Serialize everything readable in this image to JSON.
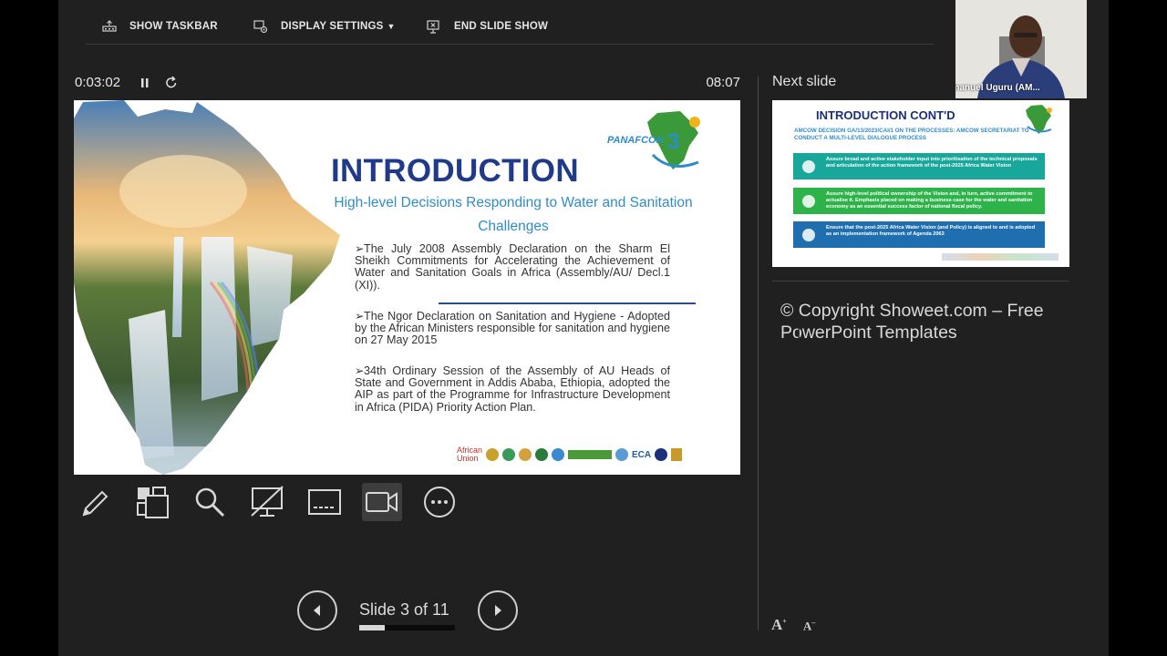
{
  "topbar": {
    "show_taskbar": "SHOW TASKBAR",
    "display_settings": "DISPLAY SETTINGS",
    "end_slide_show": "END SLIDE SHOW"
  },
  "timer": {
    "elapsed": "0:03:02",
    "clock": "08:07"
  },
  "slide": {
    "title": "INTRODUCTION",
    "subtitle": "High-level Decisions Responding to Water and Sanitation Challenges",
    "bullets": [
      "The July 2008 Assembly Declaration on the Sharm El Sheikh Commitments for Accelerating the Achievement of Water and Sanitation Goals in Africa (Assembly/AU/ Decl.1 (XI)).",
      "The Ngor Declaration on Sanitation and Hygiene - Adopted by the African Ministers responsible for sanitation and hygiene on 27 May 2015",
      "34th Ordinary Session of the Assembly of AU Heads of State and Government in Addis Ababa, Ethiopia, adopted the AIP as part of the Programme for Infrastructure Development in Africa (PIDA) Priority Action Plan."
    ],
    "logo_text": "PANAFCON",
    "logo_number": "3",
    "footer_logos": [
      "African Union",
      "ECA"
    ]
  },
  "toolbar": {
    "tools": [
      "pen-tool",
      "see-all-slides",
      "zoom",
      "black-screen",
      "subtitles",
      "camera",
      "more-options"
    ]
  },
  "nav": {
    "label": "Slide 3 of 11",
    "progress": 0.27
  },
  "next_slide": {
    "header": "Next slide",
    "title": "INTRODUCTION CONT'D",
    "subtitle": "AMCOW DECISION GA/13/2023/CAI/1 ON THE PROCESSES: AMCOW SECRETARIAT TO CONDUCT A MULTI-LEVEL DIALOGUE PROCESS",
    "boxes": [
      "Assure broad and active stakeholder input into prioritisation of the technical proposals and articulation of the action framework of the post-2025 Africa Water Vision",
      "Assure high-level political ownership of the Vision and, in turn, active commitment to actualise it. Emphasis placed on making a business case for the water and sanitation economy as an essential success factor of national fiscal policy.",
      "Ensure that the post-2025 Africa Water Vision (and Policy) is aligned to and is adopted as an implementation framework of Agenda 2063"
    ]
  },
  "notes": "© Copyright Showeet.com – Free PowerPoint Templates",
  "webcam": {
    "name": "Emmanuel Uguru (AM..."
  },
  "colors": {
    "background": "#202020",
    "title_blue": "#1f3a8a",
    "subtitle_blue": "#2e8dc8"
  }
}
